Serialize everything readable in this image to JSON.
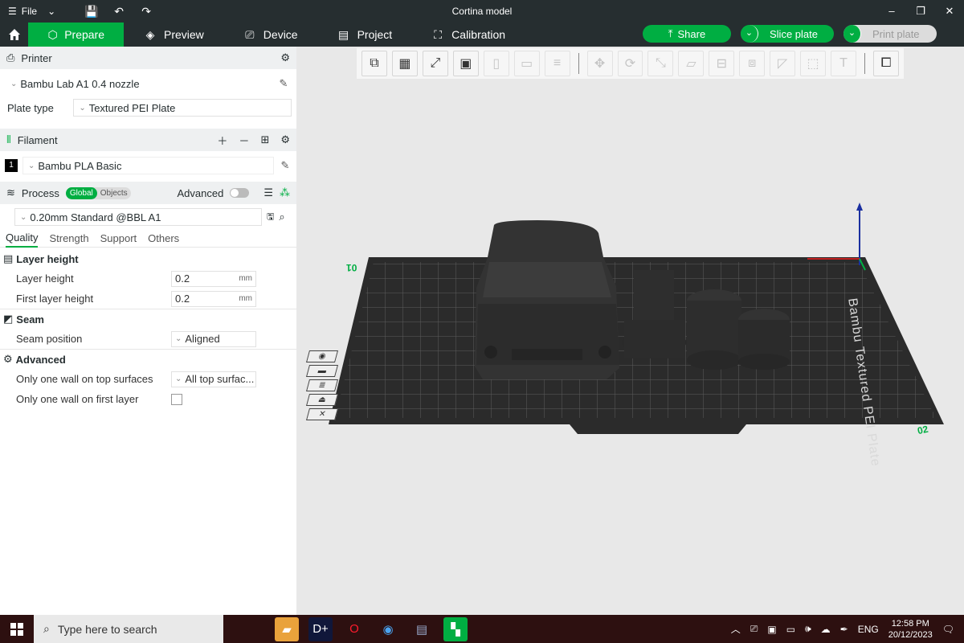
{
  "window": {
    "title": "Cortina model",
    "file_label": "File",
    "controls": [
      "–",
      "❐",
      "✕"
    ]
  },
  "tabs": [
    {
      "label": "Prepare",
      "active": true
    },
    {
      "label": "Preview"
    },
    {
      "label": "Device"
    },
    {
      "label": "Project"
    },
    {
      "label": "Calibration"
    }
  ],
  "actions": {
    "share": "Share",
    "slice_plate": "Slice plate",
    "print_plate": "Print plate"
  },
  "printer": {
    "heading": "Printer",
    "model": "Bambu Lab A1 0.4 nozzle",
    "plate_type_label": "Plate type",
    "plate_type": "Textured PEI Plate"
  },
  "filament": {
    "heading": "Filament",
    "slot": "1",
    "name": "Bambu PLA Basic",
    "color": "#000000"
  },
  "process": {
    "heading": "Process",
    "toggle_global": "Global",
    "toggle_objects": "Objects",
    "advanced_label": "Advanced",
    "preset": "0.20mm Standard @BBL A1",
    "subtabs": [
      "Quality",
      "Strength",
      "Support",
      "Others"
    ],
    "groups": {
      "layer_height": "Layer height",
      "seam": "Seam",
      "advanced": "Advanced"
    },
    "params": {
      "layer_height_label": "Layer height",
      "layer_height_value": "0.2",
      "first_layer_height_label": "First layer height",
      "first_layer_height_value": "0.2",
      "unit": "mm",
      "seam_position_label": "Seam position",
      "seam_position_value": "Aligned",
      "one_wall_top_label": "Only one wall on top surfaces",
      "one_wall_top_value": "All top surfac...",
      "one_wall_first_label": "Only one wall on first layer"
    }
  },
  "viewport": {
    "bed_label": "Bambu Textured PEI Plate",
    "plate_number": "01",
    "plate_number_corner": "02"
  },
  "taskbar": {
    "search_placeholder": "Type here to search",
    "language": "ENG",
    "time": "12:58 PM",
    "date": "20/12/2023"
  },
  "colors": {
    "accent": "#00ae42",
    "dark": "#262e30",
    "bed": "#2b2b2b"
  }
}
